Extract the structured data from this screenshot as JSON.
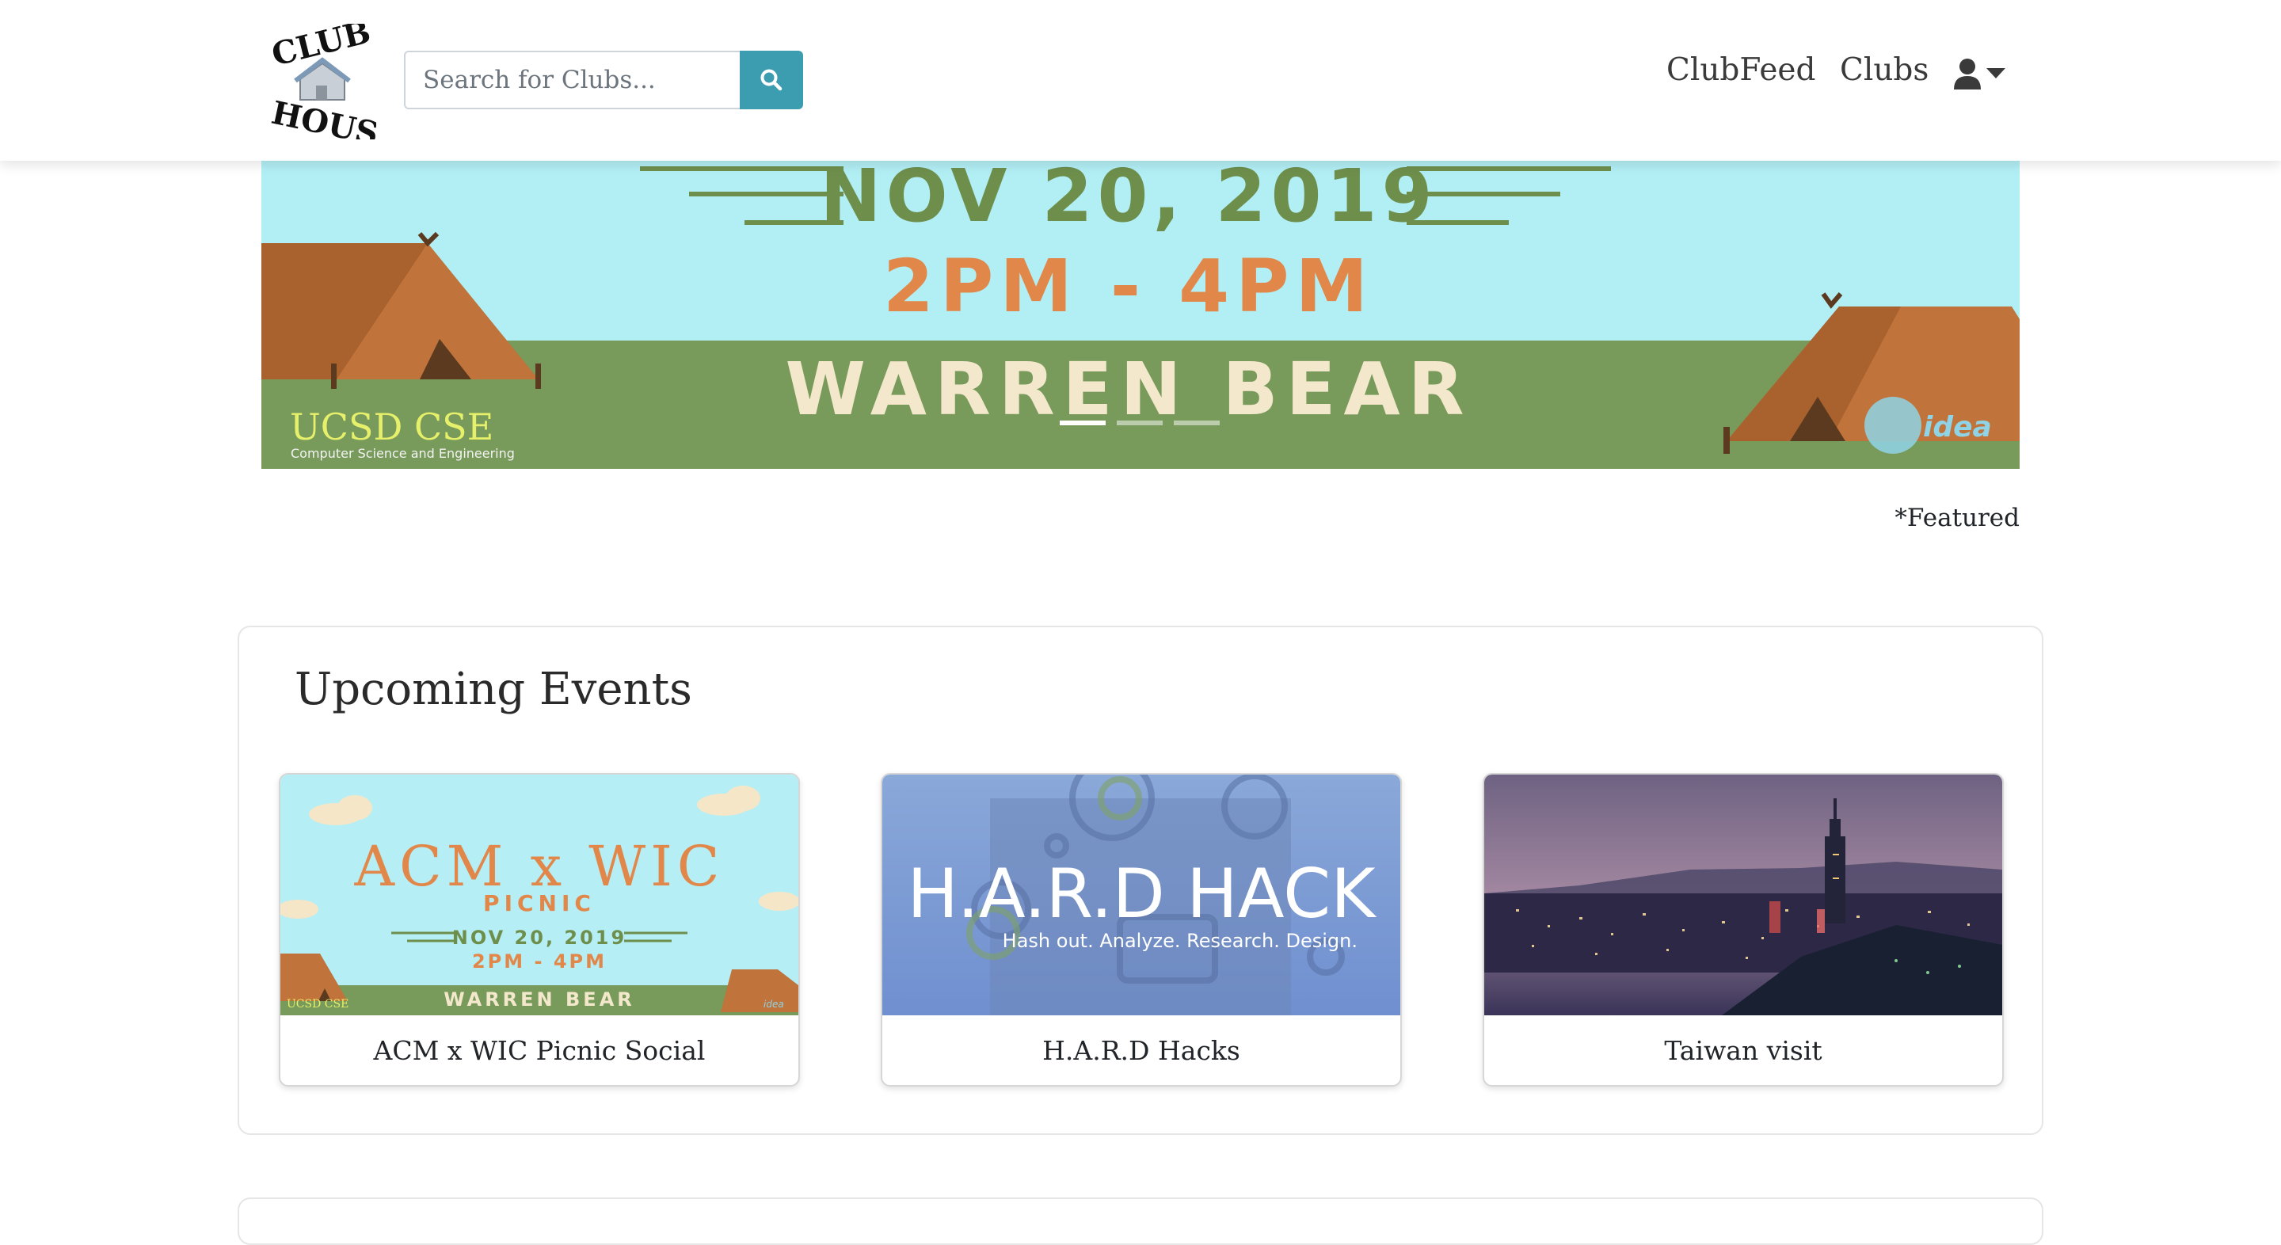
{
  "header": {
    "logo_text_top": "CLUB",
    "logo_text_bottom": "HOUSE",
    "search_placeholder": "Search for Clubs...",
    "nav": {
      "clubfeed": "ClubFeed",
      "clubs": "Clubs"
    },
    "icons": {
      "search": "search-icon",
      "user": "user-icon",
      "caret": "caret-down-icon"
    }
  },
  "banner": {
    "date": "NOV 20, 2019",
    "time": "2PM - 4PM",
    "location": "WARREN BEAR",
    "sponsor_left": "UCSD CSE",
    "sponsor_left_sub": "Computer Science and Engineering",
    "sponsor_right": "idea",
    "featured_label": "*Featured",
    "colors": {
      "sky": "#b2eff5",
      "grass": "#789a5b",
      "tent": "#c0733a",
      "date": "#6e8f4c",
      "time": "#e2874a",
      "location": "#f3e8cc"
    }
  },
  "events": {
    "title": "Upcoming Events",
    "items": [
      {
        "name": "ACM x WIC Picnic Social",
        "poster": {
          "headline": "ACM x WIC",
          "subhead": "PICNIC",
          "date": "NOV 20, 2019",
          "time": "2PM - 4PM",
          "location": "WARREN BEAR",
          "sponsor": "UCSD CSE",
          "sponsor_right": "idea"
        }
      },
      {
        "name": "H.A.R.D Hacks",
        "poster": {
          "headline": "H.A.R.D HACK",
          "tagline": "Hash out. Analyze. Research. Design."
        }
      },
      {
        "name": "Taiwan visit",
        "poster": {}
      }
    ]
  }
}
